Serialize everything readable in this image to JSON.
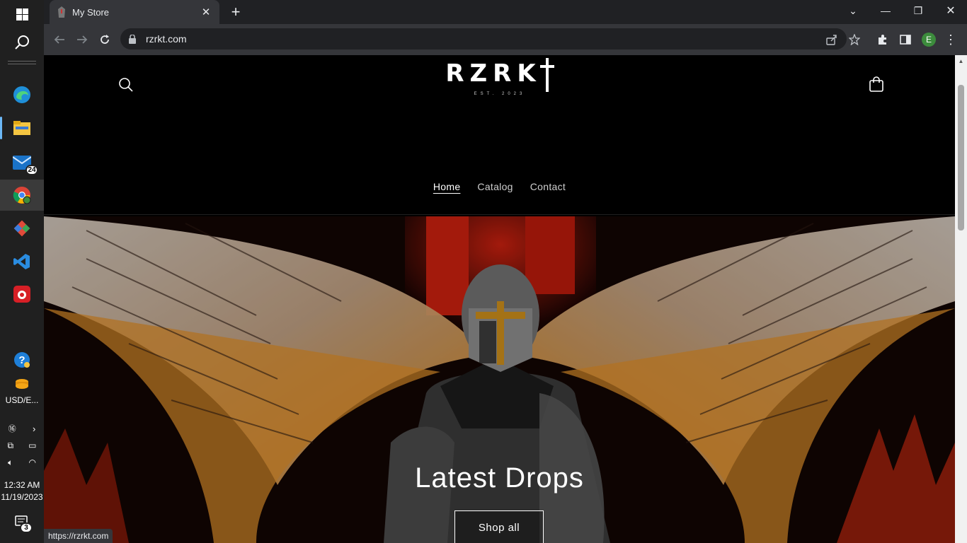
{
  "taskbar": {
    "mail_badge": "24",
    "currency_label": "USD/E...",
    "time": "12:32 AM",
    "date": "11/19/2023",
    "notification_count": "3"
  },
  "browser": {
    "tab_title": "My Store",
    "url": "rzrkt.com",
    "profile_initial": "E",
    "status_url": "https://rzrkt.com"
  },
  "site": {
    "logo_text": "RZRK",
    "logo_subtitle": "EST. 2023",
    "nav": [
      {
        "label": "Home"
      },
      {
        "label": "Catalog"
      },
      {
        "label": "Contact"
      }
    ],
    "hero": {
      "title": "Latest Drops",
      "button_label": "Shop all"
    }
  }
}
